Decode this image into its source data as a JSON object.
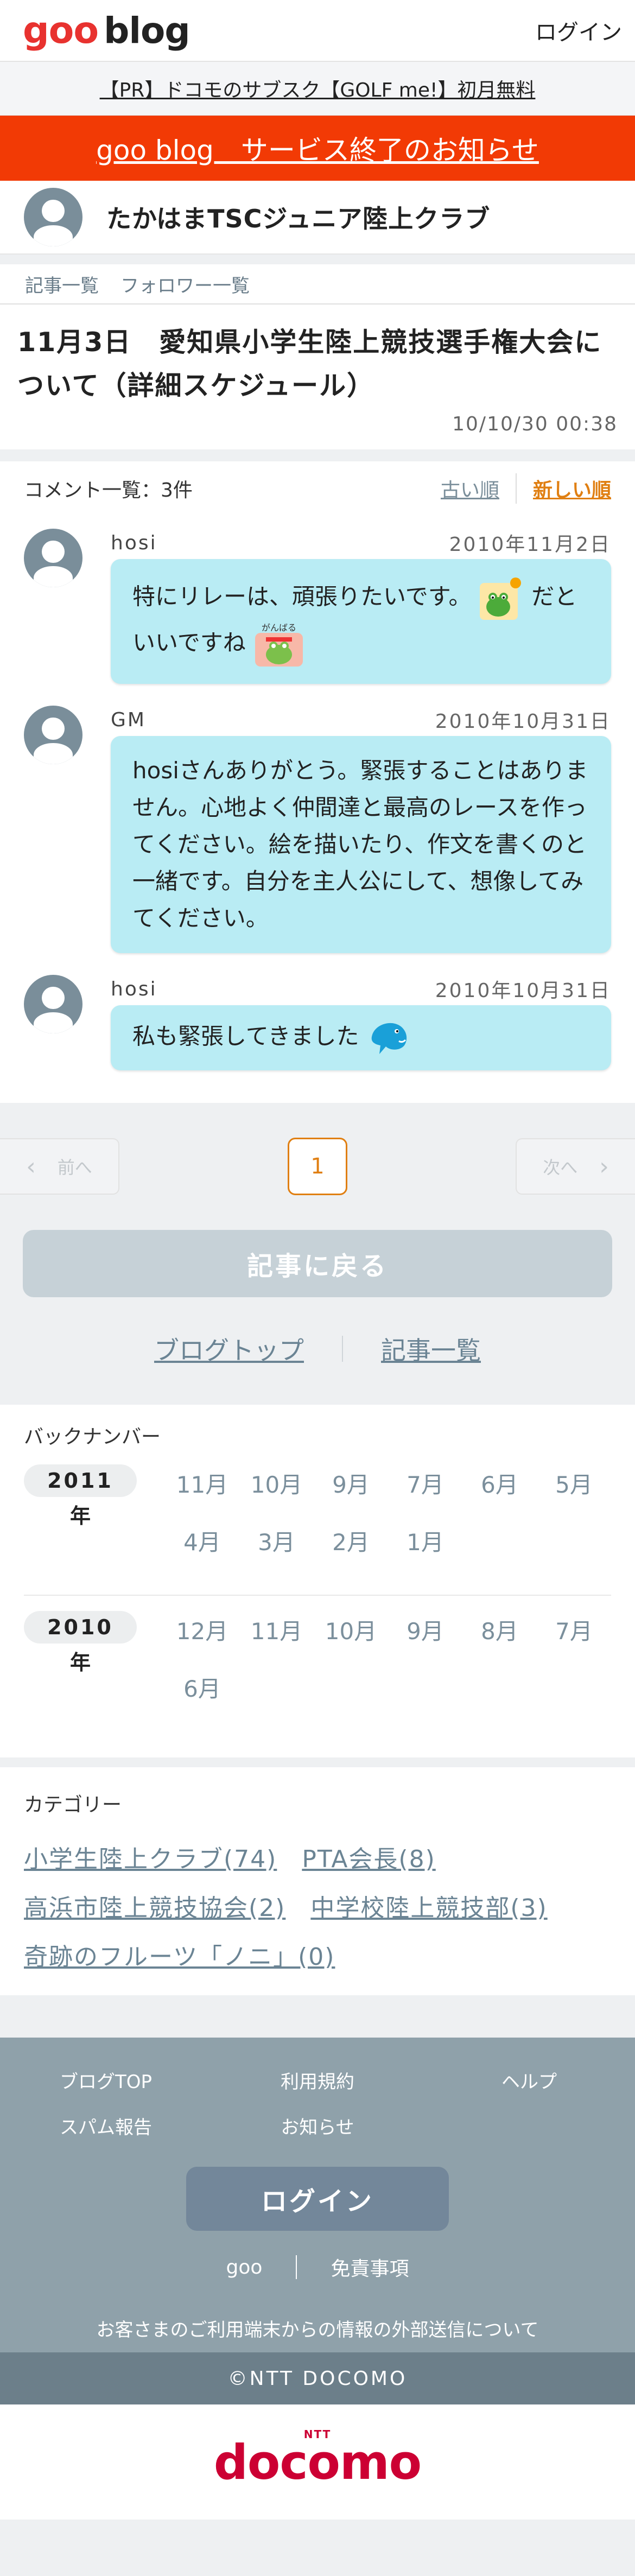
{
  "header": {
    "logo_goo": "goo",
    "logo_blog": "blog",
    "login": "ログイン"
  },
  "pr_text": "【PR】ドコモのサブスク【GOLF me!】初月無料",
  "notice": "goo blog　サービス終了のお知らせ",
  "blog": {
    "title": "たかはまTSCジュニア陸上クラブ"
  },
  "tabs": [
    "記事一覧",
    "フォロワー一覧"
  ],
  "article": {
    "title": "11月3日　愛知県小学生陸上競技選手権大会について（詳細スケジュール）",
    "date": "10/10/30 00:38"
  },
  "comments": {
    "count_label": "コメント一覧：3件",
    "sort_old": "古い順",
    "sort_new": "新しい順",
    "items": [
      {
        "author": "hosi",
        "date": "2010年11月2日",
        "text_a": "特にリレーは、頑張りたいです。",
        "text_b": "だといいですね",
        "emoji_a": "frog-sun-icon",
        "emoji_b": "frog-ganbaru-icon"
      },
      {
        "author": "GM",
        "date": "2010年10月31日",
        "text": "hosiさんありがとう。緊張することはありません。心地よく仲間達と最高のレースを作ってください。絵を描いたり、作文を書くのと一緒です。自分を主人公にして、想像してみてください。"
      },
      {
        "author": "hosi",
        "date": "2010年10月31日",
        "text": "私も緊張してきました",
        "emoji": "dolphin-icon"
      }
    ]
  },
  "pager": {
    "prev": "前へ",
    "next": "次へ",
    "current": "1"
  },
  "back_button": "記事に戻る",
  "links": {
    "blog_top": "ブログトップ",
    "article_list": "記事一覧"
  },
  "backnumber": {
    "label": "バックナンバー",
    "years": [
      {
        "year": "2011",
        "suffix": "年",
        "months": [
          "11月",
          "10月",
          "9月",
          "7月",
          "6月",
          "5月",
          "4月",
          "3月",
          "2月",
          "1月"
        ]
      },
      {
        "year": "2010",
        "suffix": "年",
        "months": [
          "12月",
          "11月",
          "10月",
          "9月",
          "8月",
          "7月",
          "6月"
        ]
      }
    ]
  },
  "category": {
    "label": "カテゴリー",
    "items": [
      "小学生陸上クラブ(74)",
      "PTA会長(8)",
      "高浜市陸上競技協会(2)",
      "中学校陸上競技部(3)",
      "奇跡のフルーツ「ノニ」(0)"
    ]
  },
  "footer": {
    "links": [
      "ブログTOP",
      "利用規約",
      "ヘルプ",
      "スパム報告",
      "お知らせ"
    ],
    "login": "ログイン",
    "goo": "goo",
    "disclaimer": "免責事項",
    "note": "お客さまのご利用端末からの情報の外部送信について",
    "copyright": "©NTT DOCOMO",
    "docomo_ntt": "NTT",
    "docomo": "docomo"
  },
  "colors": {
    "notice_bg": "#f23a05",
    "accent": "#e07f12",
    "bubble": "#b9ecf4",
    "footer_bg": "#8fa1aa",
    "docomo": "#cc0033"
  }
}
